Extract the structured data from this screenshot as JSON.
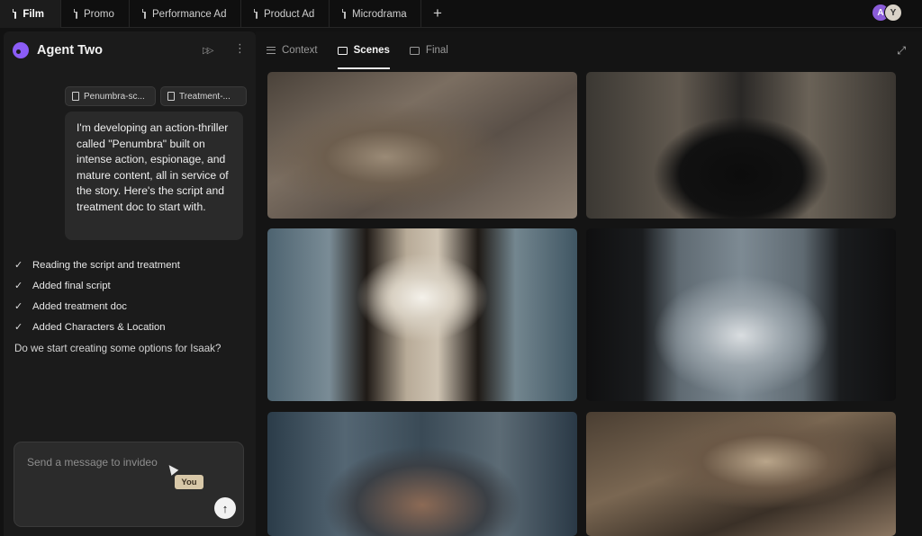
{
  "tabs": [
    {
      "label": "Film",
      "active": true
    },
    {
      "label": "Promo",
      "active": false
    },
    {
      "label": "Performance Ad",
      "active": false
    },
    {
      "label": "Product Ad",
      "active": false
    },
    {
      "label": "Microdrama",
      "active": false
    }
  ],
  "add_tab_label": "+",
  "avatars": [
    "A",
    "Y"
  ],
  "agent": {
    "title": "Agent Two",
    "fast_forward_icon": "fast-forward-icon",
    "more_icon": "more-vertical-icon"
  },
  "chat": {
    "attachments": [
      "Penumbra-sc...",
      "Treatment-..."
    ],
    "user_message": "I'm developing an action-thriller called \"Penumbra\" built on intense action, espionage, and mature content, all in service of the story. Here's the script and treatment doc to start with.",
    "steps": [
      "Reading the script and treatment",
      "Added final script",
      "Added treatment doc",
      "Added Characters & Location"
    ],
    "assistant_question": "Do we start creating some options for Isaak?",
    "composer_placeholder": "Send a message to invideo",
    "cursor_tag": "You",
    "send_icon": "arrow-up-icon"
  },
  "view_tabs": [
    {
      "label": "Context",
      "icon": "lines-icon",
      "active": false
    },
    {
      "label": "Scenes",
      "icon": "folder-icon",
      "active": true
    },
    {
      "label": "Final",
      "icon": "folder-icon",
      "active": false
    }
  ],
  "expand_icon": "expand-icon",
  "scenes_count": 6,
  "colors": {
    "accent": "#8b5cf6",
    "background": "#121212",
    "panel": "#1b1b1b"
  }
}
